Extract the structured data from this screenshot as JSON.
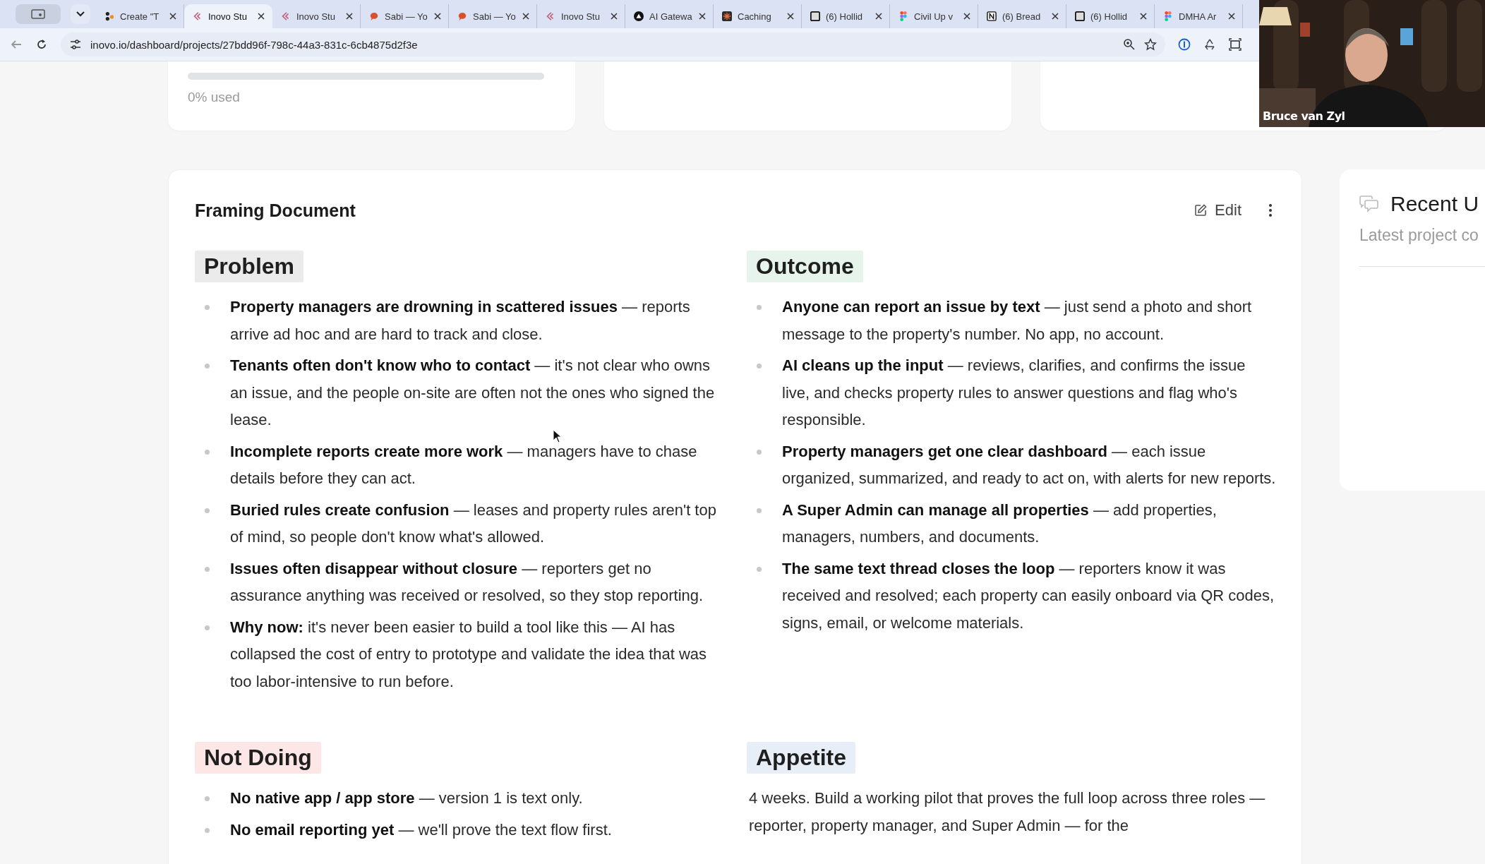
{
  "browser": {
    "tabs": [
      {
        "title": "Create \"T",
        "kind": "dots",
        "selected": false
      },
      {
        "title": "Inovo Stu",
        "kind": "chevron",
        "selected": true
      },
      {
        "title": "Inovo Stu",
        "kind": "chevron",
        "selected": false
      },
      {
        "title": "Sabi — Yo",
        "kind": "bubble",
        "selected": false
      },
      {
        "title": "Sabi — Yo",
        "kind": "bubble",
        "selected": false
      },
      {
        "title": "Inovo Stu",
        "kind": "chevron",
        "selected": false
      },
      {
        "title": "AI Gatewa",
        "kind": "triangle",
        "selected": false
      },
      {
        "title": "Caching",
        "kind": "burst",
        "selected": false
      },
      {
        "title": "(6) Hollid",
        "kind": "square",
        "selected": false
      },
      {
        "title": "Civil Up v",
        "kind": "figma",
        "selected": false
      },
      {
        "title": "(6) Bread",
        "kind": "letter",
        "selected": false
      },
      {
        "title": "(6) Hollid",
        "kind": "square",
        "selected": false
      },
      {
        "title": "DMHA Ar",
        "kind": "figma",
        "selected": false
      }
    ],
    "url": "inovo.io/dashboard/projects/27bdd96f-798c-44a3-831c-6cb4875d2f3e"
  },
  "usage": {
    "label": "0% used",
    "level": 0
  },
  "framing": {
    "title": "Framing Document",
    "edit": "Edit",
    "sections": [
      {
        "heading": "Problem",
        "color": "#ebebeb",
        "kind": "list",
        "items": [
          "**Property managers are drowning in scattered issues** — reports arrive ad hoc and are hard to track and close.",
          "**Tenants often don't know who to contact** — it's not clear who owns an issue, and the people on-site are often not the ones who signed the lease.",
          "**Incomplete reports create more work** — managers have to chase details before they can act.",
          "**Buried rules create confusion** — leases and property rules aren't top of mind, so people don't know what's allowed.",
          "**Issues often disappear without closure** — reporters get no assurance anything was received or resolved, so they stop reporting.",
          "**Why now:** it's never been easier to build a tool like this — AI has collapsed the cost of entry to prototype and validate the idea that was too labor-intensive to run before."
        ]
      },
      {
        "heading": "Outcome",
        "color": "#e6f4ec",
        "kind": "list",
        "items": [
          "**Anyone can report an issue by text** — just send a photo and short message to the property's number. No app, no account.",
          "**AI cleans up the input** — reviews, clarifies, and confirms the issue live, and checks property rules to answer questions and flag who's responsible.",
          "**Property managers get one clear dashboard** — each issue organized, summarized, and ready to act on, with alerts for new reports.",
          "**A Super Admin can manage all properties** — add properties, managers, numbers, and documents.",
          "**The same text thread closes the loop** — reporters know it was received and resolved; each property can easily onboard via QR codes, signs, email, or welcome materials."
        ]
      },
      {
        "heading": "Not Doing",
        "color": "#fde6e6",
        "kind": "list",
        "items": [
          "**No native app / app store** — version 1 is text only.",
          "**No email reporting yet** — we'll prove the text flow first."
        ]
      },
      {
        "heading": "Appetite",
        "color": "#e8eef8",
        "kind": "text",
        "text": "4 weeks. Build a working pilot that proves the full loop across three roles — reporter, property manager, and Super Admin — for the"
      }
    ]
  },
  "updates": {
    "title": "Recent U",
    "subtitle": "Latest project co"
  },
  "video": {
    "name": "Bruce van Zyl"
  }
}
